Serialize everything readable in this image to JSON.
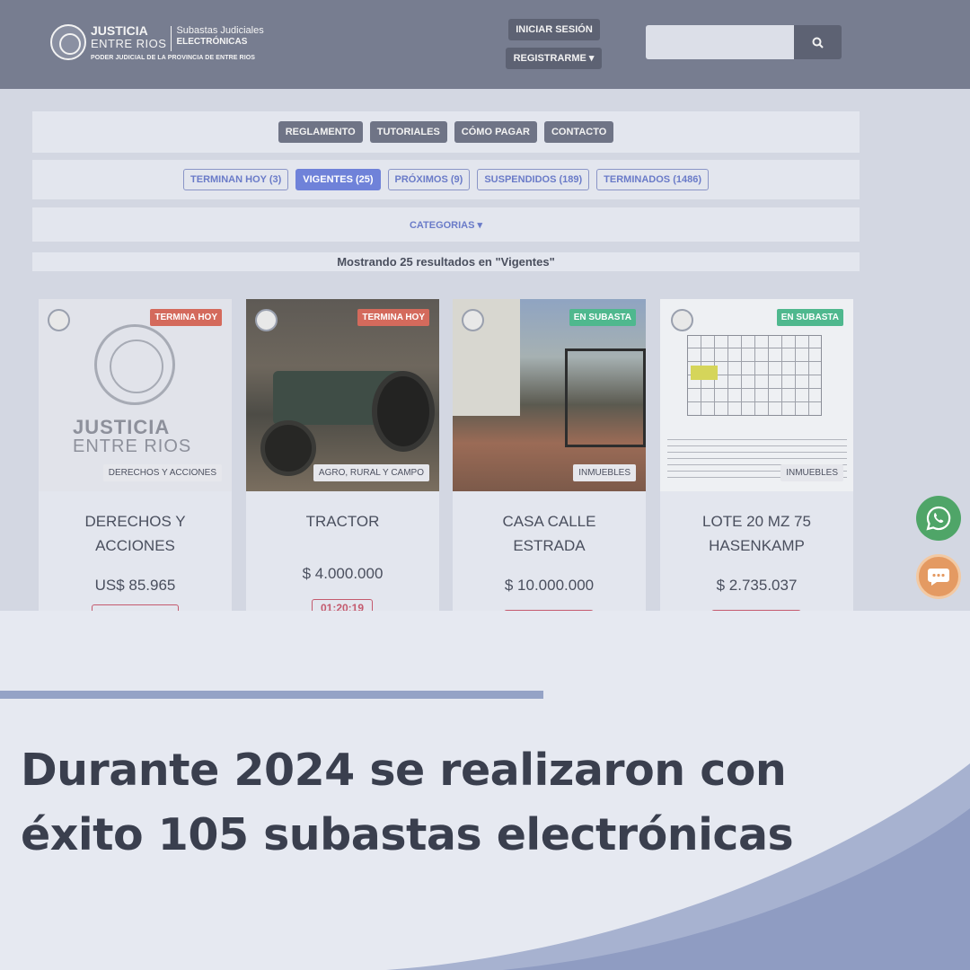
{
  "header": {
    "logo_line1": "JUSTICIA",
    "logo_line2": "ENTRE RIOS",
    "logo_sub1": "Subastas Judiciales",
    "logo_sub2": "ELECTRÓNICAS",
    "logo_footer": "PODER JUDICIAL DE LA PROVINCIA DE ENTRE RIOS",
    "login_label": "INICIAR SESIÓN",
    "register_label": "REGISTRARME ▾",
    "search_placeholder": ""
  },
  "menu": [
    "REGLAMENTO",
    "TUTORIALES",
    "CÓMO PAGAR",
    "CONTACTO"
  ],
  "tabs": [
    {
      "label": "TERMINAN HOY",
      "count": "(3)"
    },
    {
      "label": "VIGENTES",
      "count": "(25)"
    },
    {
      "label": "PRÓXIMOS",
      "count": "(9)"
    },
    {
      "label": "SUSPENDIDOS",
      "count": "(189)"
    },
    {
      "label": "TERMINADOS",
      "count": "(1486)"
    }
  ],
  "categories_label": "CATEGORIAS ▾",
  "results_text": "Mostrando 25 resultados en \"Vigentes\"",
  "cards": [
    {
      "status": "TERMINA HOY",
      "category": "DERECHOS Y ACCIONES",
      "title1": "DERECHOS Y",
      "title2": "ACCIONES",
      "price": "US$ 85.965",
      "logo_text1": "JUSTICIA",
      "logo_text2": "ENTRE RIOS"
    },
    {
      "status": "TERMINA HOY",
      "category": "AGRO, RURAL Y CAMPO",
      "title1": "TRACTOR",
      "title2": "",
      "price": "$ 4.000.000",
      "timer": "01:20:19"
    },
    {
      "status": "EN SUBASTA",
      "category": "INMUEBLES",
      "title1": "CASA CALLE",
      "title2": "ESTRADA",
      "price": "$ 10.000.000"
    },
    {
      "status": "EN SUBASTA",
      "category": "INMUEBLES",
      "title1": "LOTE 20 MZ 75",
      "title2": "HASENKAMP",
      "price": "$ 2.735.037"
    }
  ],
  "headline_line1": "Durante 2024 se realizaron con",
  "headline_line2": "éxito 105 subastas electrónicas",
  "colors": {
    "topbar": "#777d90",
    "active_tab": "#6f82d9",
    "badge_red": "#d46a5c",
    "badge_green": "#4fb88e",
    "accent_line": "#95a3c6",
    "headline": "#3a3f4e"
  },
  "icons": [
    "search-icon",
    "whatsapp-icon",
    "chat-icon"
  ]
}
